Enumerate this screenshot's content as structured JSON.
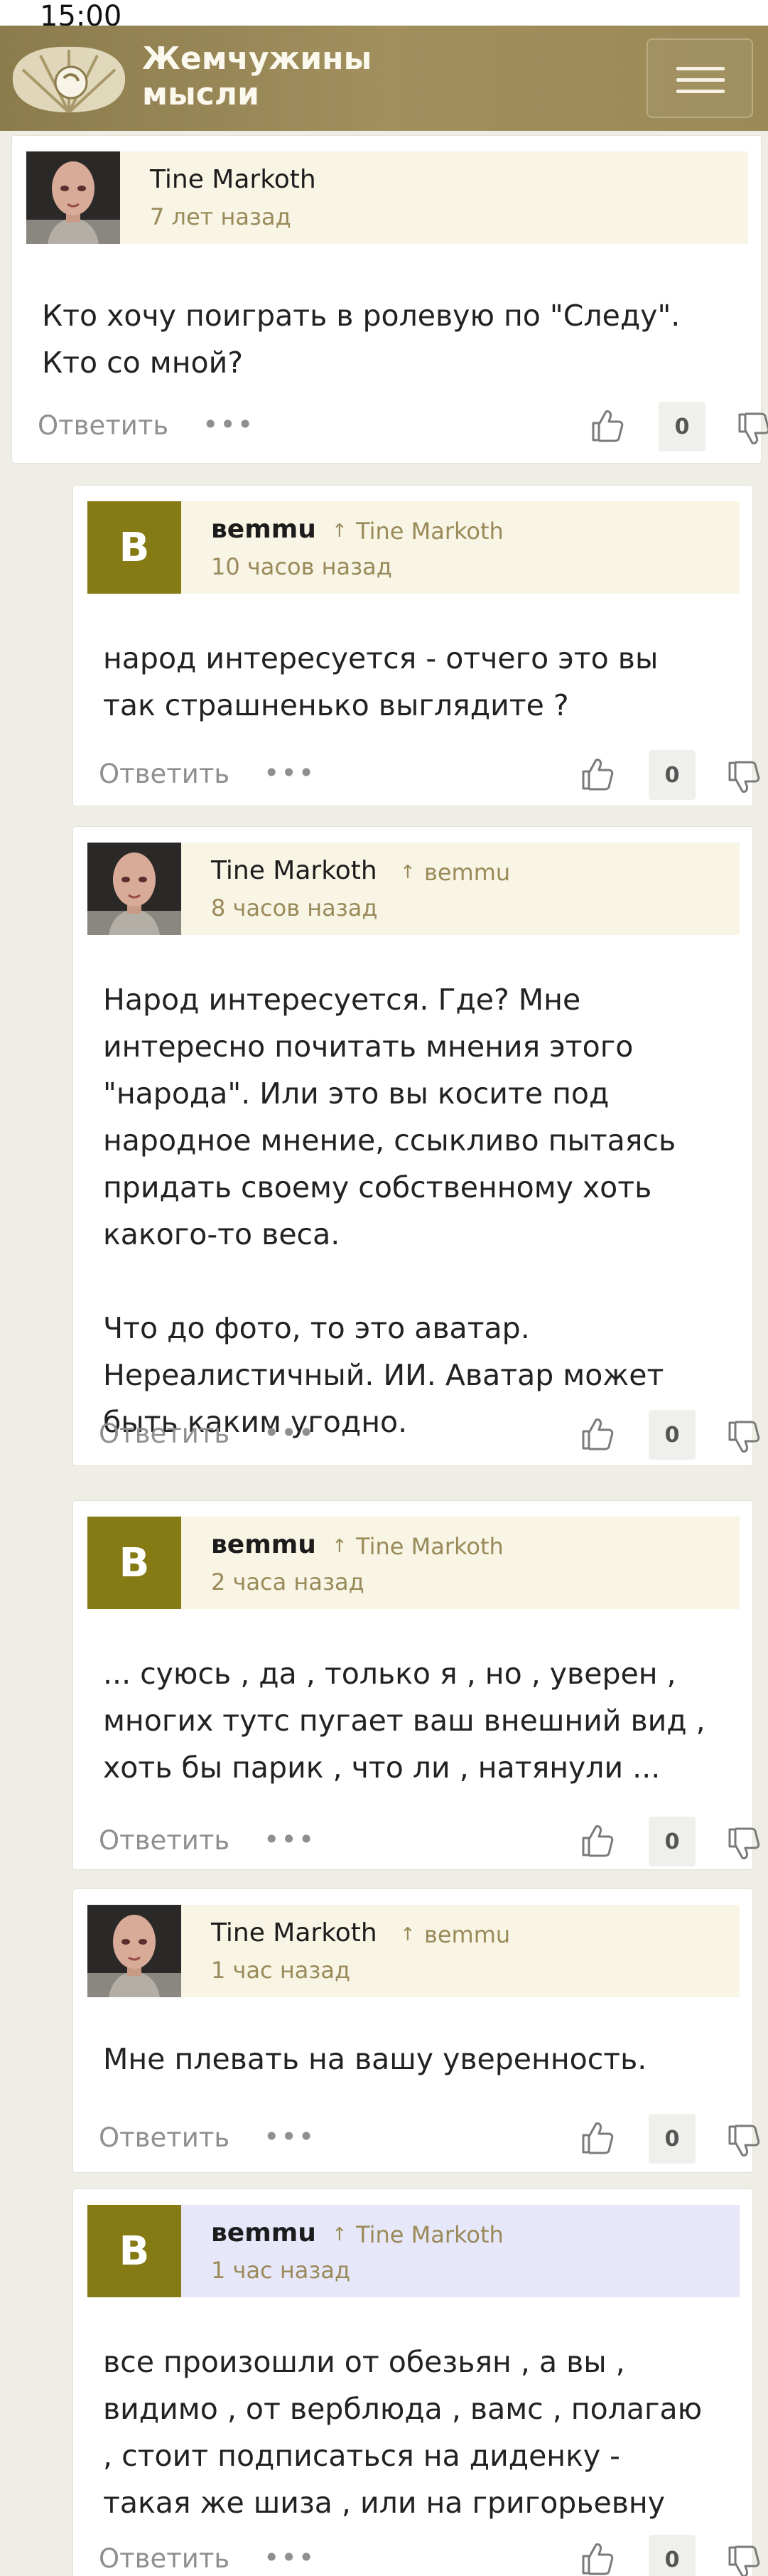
{
  "status_bar": {
    "time": "15:00"
  },
  "header": {
    "logo_line1": "Жемчужины",
    "logo_line2": "мысли",
    "logo_icon": "pearl-shell-icon",
    "menu_icon": "hamburger-menu-icon"
  },
  "colors": {
    "header": "#9a8855",
    "author_band": "#f8f5e5",
    "author_band_highlight": "#e7e7fa",
    "letter_avatar": "#857a14",
    "accent_text": "#9a8a5a"
  },
  "actions": {
    "reply_label": "Ответить",
    "more_label": "•••"
  },
  "comments": [
    {
      "author": "Tine Markoth",
      "reply_to": "",
      "time": "7 лет назад",
      "avatar_letter": "",
      "paragraphs": [
        "Кто хочу поиграть в ролевую по \"Следу\". Кто со мной?"
      ],
      "votes": "0",
      "highlighted": false
    },
    {
      "author": "веmmu",
      "reply_to": "Tine Markoth",
      "time": "10 часов назад",
      "avatar_letter": "B",
      "paragraphs": [
        "народ интересуется - отчего это вы так страшненько выглядите ?"
      ],
      "votes": "0",
      "highlighted": false
    },
    {
      "author": "Tine Markoth",
      "reply_to": "веmmu",
      "time": "8 часов назад",
      "avatar_letter": "",
      "paragraphs": [
        "Народ интересуется. Где? Мне интересно почитать мнения этого \"народа\". Или это вы косите под народное мнение, ссыкливо пытаясь придать своему собственному хоть какого-то веса.",
        "Что до фото, то это аватар. Нереалистичный. ИИ. Аватар может быть каким угодно."
      ],
      "votes": "0",
      "highlighted": false
    },
    {
      "author": "веmmu",
      "reply_to": "Tine Markoth",
      "time": "2 часа назад",
      "avatar_letter": "B",
      "paragraphs": [
        "... суюсь , да , только я , но , уверен , многих тутс пугает ваш внешний вид , хоть бы парик , что ли , натянули ..."
      ],
      "votes": "0",
      "highlighted": false
    },
    {
      "author": "Tine Markoth",
      "reply_to": "веmmu",
      "time": "1 час назад",
      "avatar_letter": "",
      "paragraphs": [
        "Мне плевать на вашу уверенность."
      ],
      "votes": "0",
      "highlighted": false
    },
    {
      "author": "веmmu",
      "reply_to": "Tine Markoth",
      "time": "1 час назад",
      "avatar_letter": "B",
      "paragraphs": [
        "все произошли от обезьян , а вы , видимо , от верблюда , вамс , полагаю , стоит подписаться на диденку - такая же шиза , или на григорьевну"
      ],
      "votes": "0",
      "highlighted": true
    }
  ]
}
